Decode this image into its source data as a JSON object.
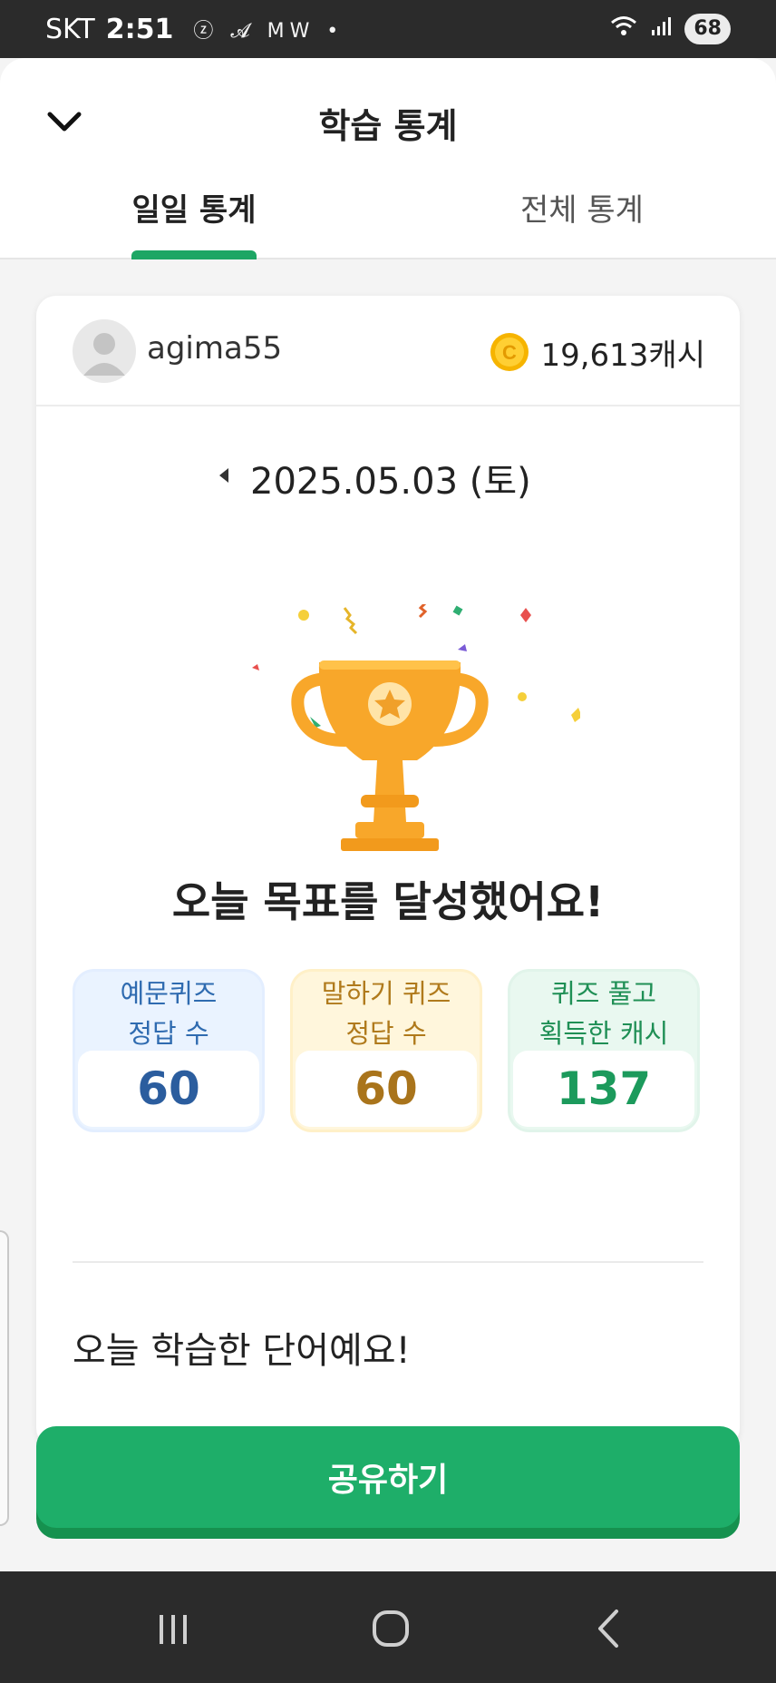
{
  "status_bar": {
    "carrier": "SKT",
    "time": "2:51",
    "notifications": "ⓩ 𝓐 MW •",
    "battery": "68"
  },
  "header": {
    "title": "학습 통계",
    "tabs": [
      {
        "label": "일일 통계",
        "active": true
      },
      {
        "label": "전체 통계",
        "active": false
      }
    ]
  },
  "profile": {
    "username": "agima55",
    "cash": "19,613캐시"
  },
  "date": {
    "text": "2025.05.03 (토)"
  },
  "goal": {
    "message": "오늘 목표를 달성했어요!"
  },
  "stats": [
    {
      "label_line1": "예문퀴즈",
      "label_line2": "정답 수",
      "value": "60",
      "color": "#2b5d9e"
    },
    {
      "label_line1": "말하기 퀴즈",
      "label_line2": "정답 수",
      "value": "60",
      "color": "#a9741b"
    },
    {
      "label_line1": "퀴즈 풀고",
      "label_line2": "획득한 캐시",
      "value": "137",
      "color": "#1c9a5c"
    }
  ],
  "words": {
    "title": "오늘 학습한 단어예요!"
  },
  "share_button": {
    "label": "공유하기"
  },
  "colors": {
    "accent_green": "#1eae69",
    "tab_indicator": "#1da664",
    "trophy": "#f8a72a"
  },
  "icons": {
    "collapse": "chevron-down-icon",
    "coin": "coin-icon",
    "prev": "caret-left-icon",
    "trophy": "trophy-icon"
  }
}
